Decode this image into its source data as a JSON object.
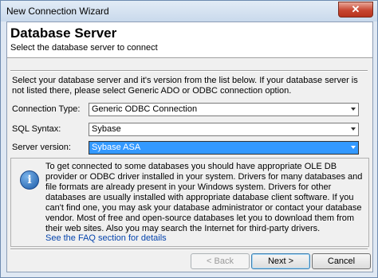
{
  "window": {
    "title": "New Connection Wizard",
    "close_glyph": "✕"
  },
  "header": {
    "title": "Database Server",
    "subtitle": "Select the database server to connect"
  },
  "intro": "Select your database server and it's version from the list below. If your database server is not listed there, please select Generic ADO or ODBC connection option.",
  "form": {
    "connection_type": {
      "label": "Connection Type:",
      "value": "Generic ODBC Connection"
    },
    "sql_syntax": {
      "label": "SQL Syntax:",
      "value": "Sybase"
    },
    "server_version": {
      "label": "Server version:",
      "value": "Sybase ASA"
    }
  },
  "info": {
    "icon": "info-icon",
    "text": "To get connected to some databases you should have appropriate OLE DB provider or ODBC driver installed in your system. Drivers for many databases and file formats are already present in your Windows system. Drivers for other databases are usually installed with appropriate database client software. If you can't find one, you may ask your database administrator or contact your database vendor. Most of free and open-source databases let you to download them from their web sites. Also you may search  the Internet for third-party drivers.",
    "link": "See the FAQ section for details"
  },
  "buttons": {
    "back": "< Back",
    "next": "Next >",
    "cancel": "Cancel"
  },
  "colors": {
    "selection": "#3399ff",
    "link": "#0645ad",
    "accent": "#3c7fb1"
  }
}
